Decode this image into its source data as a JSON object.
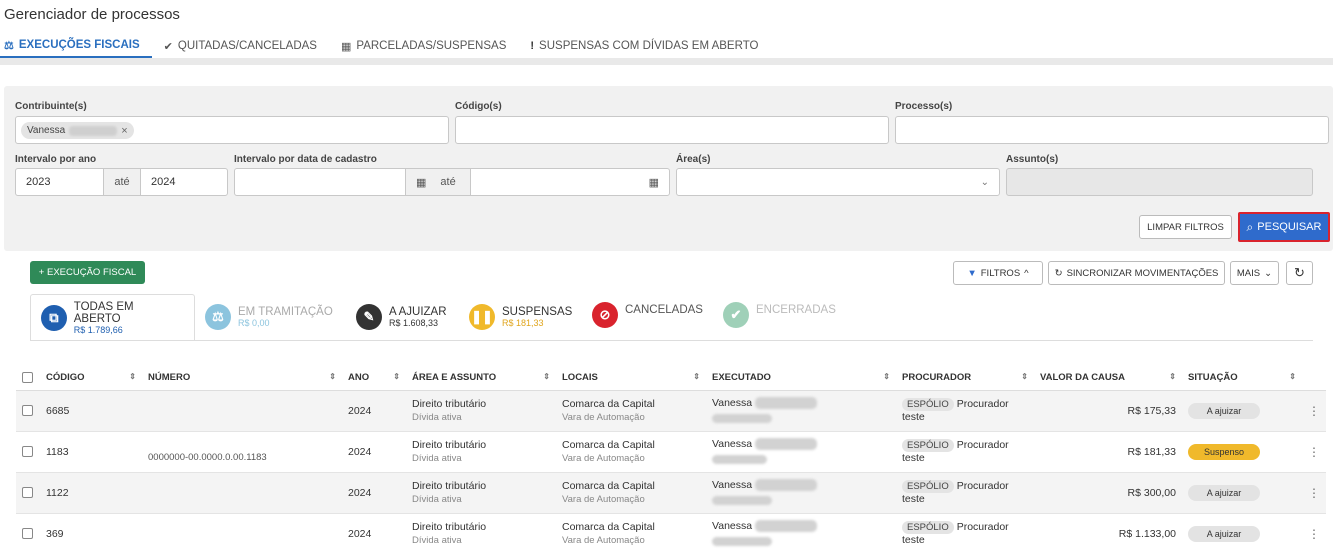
{
  "page_title": "Gerenciador de processos",
  "top_tabs": [
    {
      "icon": "scale-icon",
      "label": "EXECUÇÕES FISCAIS"
    },
    {
      "icon": "check-icon",
      "label": "QUITADAS/CANCELADAS"
    },
    {
      "icon": "calendar-icon",
      "label": "PARCELADAS/SUSPENSAS"
    },
    {
      "icon": "exclamation-icon",
      "label": "SUSPENSAS COM DÍVIDAS EM ABERTO"
    }
  ],
  "filters": {
    "contribuinte_label": "Contribuinte(s)",
    "contribuinte_chip": "Vanessa",
    "codigo_label": "Código(s)",
    "processo_label": "Processo(s)",
    "intervalo_ano_label": "Intervalo por ano",
    "ano_inicio": "2023",
    "ate": "até",
    "ano_fim": "2024",
    "intervalo_data_label": "Intervalo por data de cadastro",
    "area_label": "Área(s)",
    "assunto_label": "Assunto(s)"
  },
  "buttons": {
    "limpar": "LIMPAR FILTROS",
    "pesquisar": "PESQUISAR",
    "nova_execucao": "+ EXECUÇÃO FISCAL",
    "filtros": "FILTROS",
    "sincronizar": "SINCRONIZAR MOVIMENTAÇÕES",
    "mais": "MAIS"
  },
  "status_tabs": [
    {
      "label": "TODAS EM ABERTO",
      "value": "R$ 1.789,66",
      "color": "#1f5fb0"
    },
    {
      "label": "EM TRAMITAÇÃO",
      "value": "R$ 0,00",
      "color": "#8cc4de"
    },
    {
      "label": "A AJUIZAR",
      "value": "R$ 1.608,33",
      "color": "#333333"
    },
    {
      "label": "SUSPENSAS",
      "value": "R$ 181,33",
      "color": "#f0b92b"
    },
    {
      "label": "CANCELADAS",
      "value": "",
      "color": "#d9232d"
    },
    {
      "label": "ENCERRADAS",
      "value": "",
      "color": "#9fd0b8"
    }
  ],
  "table": {
    "headers": [
      "CÓDIGO",
      "NÚMERO",
      "ANO",
      "ÁREA E ASSUNTO",
      "LOCAIS",
      "EXECUTADO",
      "PROCURADOR",
      "VALOR DA CAUSA",
      "SITUAÇÃO"
    ],
    "rows": [
      {
        "codigo": "6685",
        "numero": "",
        "ano": "2024",
        "area": "Direito tributário",
        "assunto": "Dívida ativa",
        "local": "Comarca da Capital",
        "vara": "Vara de Automação",
        "executado": "Vanessa",
        "tag": "ESPÓLIO",
        "procurador1": "Procurador",
        "procurador2": "teste",
        "valor": "R$ 175,33",
        "situacao": "A ajuizar"
      },
      {
        "codigo": "1183",
        "numero": "0000000-00.0000.0.00.1183",
        "ano": "2024",
        "area": "Direito tributário",
        "assunto": "Dívida ativa",
        "local": "Comarca da Capital",
        "vara": "Vara de Automação",
        "executado": "Vanessa",
        "tag": "ESPÓLIO",
        "procurador1": "Procurador",
        "procurador2": "teste",
        "valor": "R$ 181,33",
        "situacao": "Suspenso"
      },
      {
        "codigo": "1122",
        "numero": "",
        "ano": "2024",
        "area": "Direito tributário",
        "assunto": "Dívida ativa",
        "local": "Comarca da Capital",
        "vara": "Vara de Automação",
        "executado": "Vanessa",
        "tag": "ESPÓLIO",
        "procurador1": "Procurador",
        "procurador2": "teste",
        "valor": "R$ 300,00",
        "situacao": "A ajuizar"
      },
      {
        "codigo": "369",
        "numero": "",
        "ano": "2024",
        "area": "Direito tributário",
        "assunto": "Dívida ativa",
        "local": "Comarca da Capital",
        "vara": "Vara de Automação",
        "executado": "Vanessa",
        "tag": "ESPÓLIO",
        "procurador1": "Procurador",
        "procurador2": "teste",
        "valor": "R$ 1.133,00",
        "situacao": "A ajuizar"
      }
    ]
  }
}
